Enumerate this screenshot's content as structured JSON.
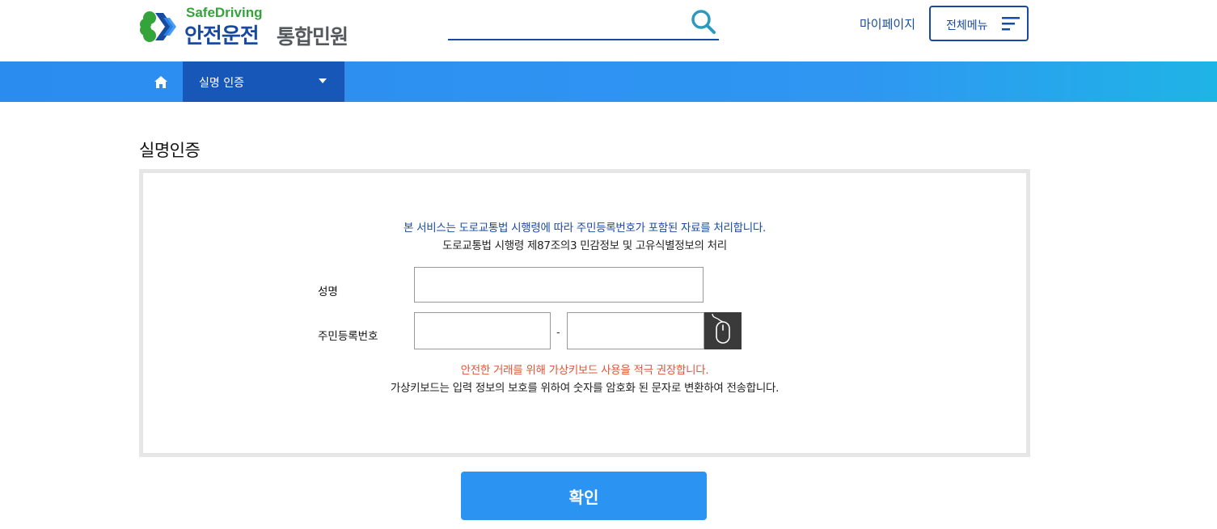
{
  "header": {
    "logo_en": "SafeDriving",
    "logo_ko": "안전운전",
    "logo_ko2": "통합민원",
    "search_placeholder": "",
    "mypage_label": "마이페이지",
    "allmenu_label": "전체메뉴"
  },
  "nav": {
    "home_icon": "home-icon",
    "current_menu": "실명 인증"
  },
  "main": {
    "title": "실명인증",
    "notice_line1": "본 서비스는 도로교통법 시행령에 따라 주민등록번호가 포함된 자료를 처리합니다.",
    "notice_line2": "도로교통법 시행령 제87조의3 민감정보 및 고유식별정보의 처리",
    "form": {
      "name_label": "성명",
      "name_value": "",
      "rrn_label": "주민등록번호",
      "rrn_front_value": "",
      "rrn_separator": "-",
      "rrn_back_value": "",
      "virtual_keyboard_icon": "mouse-icon"
    },
    "warning": "안전한 거래를 위해 가상키보드 사용을 적극 권장합니다.",
    "info": "가상키보드는 입력 정보의 보호를 위하여 숫자를 암호화 된 문자로 변환하여 전송합니다.",
    "confirm_label": "확인"
  },
  "colors": {
    "brand_blue": "#1a4aa0",
    "nav_blue": "#2b8cf0",
    "nav_active": "#1657b8",
    "logo_green": "#34a33a",
    "warning_red": "#e0563a",
    "button_blue": "#2b93f2"
  }
}
